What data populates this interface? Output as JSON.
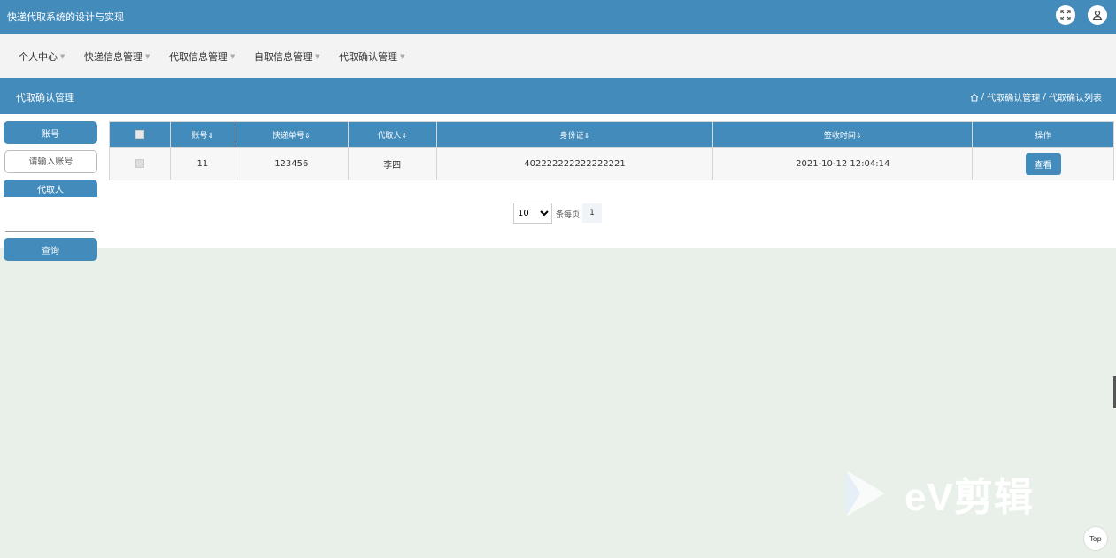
{
  "app": {
    "title": "快递代取系统的设计与实现"
  },
  "header_icons": {
    "fullscreen": "expand-icon",
    "user": "user-icon"
  },
  "menu": [
    {
      "label": "个人中心"
    },
    {
      "label": "快递信息管理"
    },
    {
      "label": "代取信息管理"
    },
    {
      "label": "自取信息管理"
    },
    {
      "label": "代取确认管理"
    }
  ],
  "section": {
    "title": "代取确认管理",
    "breadcrumb": [
      "代取确认管理",
      "代取确认列表"
    ],
    "separator": "/"
  },
  "search": {
    "account_label": "账号",
    "account_placeholder": "请输入账号",
    "agent_label": "代取人",
    "query_label": "查询"
  },
  "table": {
    "headers": [
      "账号",
      "快递单号",
      "代取人",
      "身份证",
      "签收时间",
      "操作"
    ],
    "sort_glyph": "⇕",
    "rows": [
      {
        "account": "11",
        "tracking": "123456",
        "agent": "李四",
        "id_card": "402222222222222221",
        "signed_at": "2021-10-12 12:04:14",
        "action": "查看"
      }
    ]
  },
  "pagination": {
    "page_size": "10",
    "page_size_options": [
      "10"
    ],
    "per_page_label": "条每页",
    "current_page": "1"
  },
  "watermark": {
    "text": "eV剪辑"
  },
  "top_button": {
    "label": "Top"
  },
  "colors": {
    "primary": "#428bba",
    "menu_bg": "#f3f3f3",
    "page_bg": "#e8f0e9"
  }
}
